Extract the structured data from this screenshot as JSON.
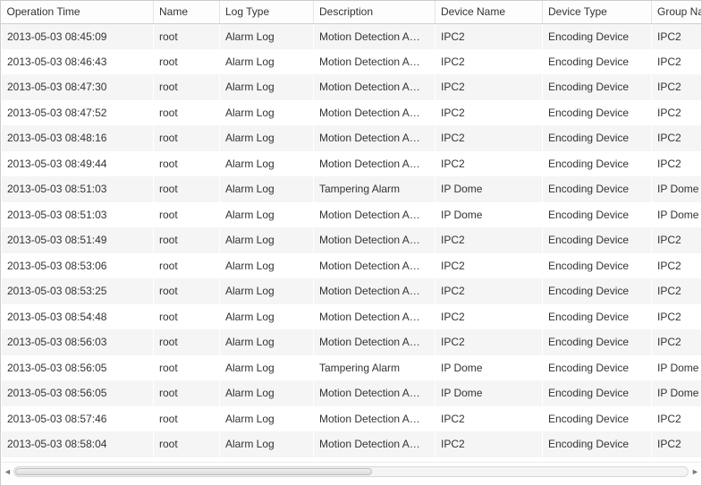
{
  "columns": {
    "operation_time": "Operation Time",
    "name": "Name",
    "log_type": "Log Type",
    "description": "Description",
    "device_name": "Device Name",
    "device_type": "Device Type",
    "group_name": "Group Name"
  },
  "rows": [
    {
      "operation_time": "2013-05-03 08:45:09",
      "name": "root",
      "log_type": "Alarm Log",
      "description": "Motion Detection A…",
      "device_name": "IPC2",
      "device_type": "Encoding Device",
      "group_name": "IPC2"
    },
    {
      "operation_time": "2013-05-03 08:46:43",
      "name": "root",
      "log_type": "Alarm Log",
      "description": "Motion Detection A…",
      "device_name": "IPC2",
      "device_type": "Encoding Device",
      "group_name": "IPC2"
    },
    {
      "operation_time": "2013-05-03 08:47:30",
      "name": "root",
      "log_type": "Alarm Log",
      "description": "Motion Detection A…",
      "device_name": "IPC2",
      "device_type": "Encoding Device",
      "group_name": "IPC2"
    },
    {
      "operation_time": "2013-05-03 08:47:52",
      "name": "root",
      "log_type": "Alarm Log",
      "description": "Motion Detection A…",
      "device_name": "IPC2",
      "device_type": "Encoding Device",
      "group_name": "IPC2"
    },
    {
      "operation_time": "2013-05-03 08:48:16",
      "name": "root",
      "log_type": "Alarm Log",
      "description": "Motion Detection A…",
      "device_name": "IPC2",
      "device_type": "Encoding Device",
      "group_name": "IPC2"
    },
    {
      "operation_time": "2013-05-03 08:49:44",
      "name": "root",
      "log_type": "Alarm Log",
      "description": "Motion Detection A…",
      "device_name": "IPC2",
      "device_type": "Encoding Device",
      "group_name": "IPC2"
    },
    {
      "operation_time": "2013-05-03 08:51:03",
      "name": "root",
      "log_type": "Alarm Log",
      "description": "Tampering Alarm",
      "device_name": "IP Dome",
      "device_type": "Encoding Device",
      "group_name": "IP Dome"
    },
    {
      "operation_time": "2013-05-03 08:51:03",
      "name": "root",
      "log_type": "Alarm Log",
      "description": "Motion Detection A…",
      "device_name": "IP Dome",
      "device_type": "Encoding Device",
      "group_name": "IP Dome"
    },
    {
      "operation_time": "2013-05-03 08:51:49",
      "name": "root",
      "log_type": "Alarm Log",
      "description": "Motion Detection A…",
      "device_name": "IPC2",
      "device_type": "Encoding Device",
      "group_name": "IPC2"
    },
    {
      "operation_time": "2013-05-03 08:53:06",
      "name": "root",
      "log_type": "Alarm Log",
      "description": "Motion Detection A…",
      "device_name": "IPC2",
      "device_type": "Encoding Device",
      "group_name": "IPC2"
    },
    {
      "operation_time": "2013-05-03 08:53:25",
      "name": "root",
      "log_type": "Alarm Log",
      "description": "Motion Detection A…",
      "device_name": "IPC2",
      "device_type": "Encoding Device",
      "group_name": "IPC2"
    },
    {
      "operation_time": "2013-05-03 08:54:48",
      "name": "root",
      "log_type": "Alarm Log",
      "description": "Motion Detection A…",
      "device_name": "IPC2",
      "device_type": "Encoding Device",
      "group_name": "IPC2"
    },
    {
      "operation_time": "2013-05-03 08:56:03",
      "name": "root",
      "log_type": "Alarm Log",
      "description": "Motion Detection A…",
      "device_name": "IPC2",
      "device_type": "Encoding Device",
      "group_name": "IPC2"
    },
    {
      "operation_time": "2013-05-03 08:56:05",
      "name": "root",
      "log_type": "Alarm Log",
      "description": "Tampering Alarm",
      "device_name": "IP Dome",
      "device_type": "Encoding Device",
      "group_name": "IP Dome"
    },
    {
      "operation_time": "2013-05-03 08:56:05",
      "name": "root",
      "log_type": "Alarm Log",
      "description": "Motion Detection A…",
      "device_name": "IP Dome",
      "device_type": "Encoding Device",
      "group_name": "IP Dome"
    },
    {
      "operation_time": "2013-05-03 08:57:46",
      "name": "root",
      "log_type": "Alarm Log",
      "description": "Motion Detection A…",
      "device_name": "IPC2",
      "device_type": "Encoding Device",
      "group_name": "IPC2"
    },
    {
      "operation_time": "2013-05-03 08:58:04",
      "name": "root",
      "log_type": "Alarm Log",
      "description": "Motion Detection A…",
      "device_name": "IPC2",
      "device_type": "Encoding Device",
      "group_name": "IPC2"
    }
  ]
}
